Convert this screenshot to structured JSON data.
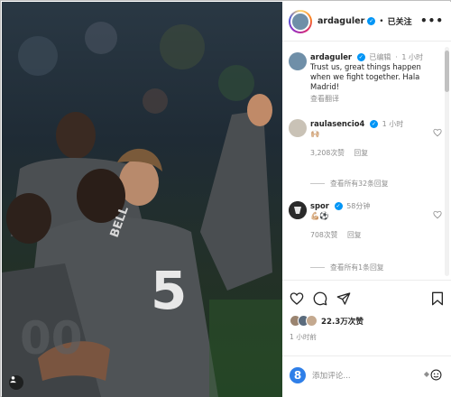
{
  "post": {
    "author": "ardaguler",
    "follow_status": "已关注",
    "more_label": "•••",
    "caption": {
      "edited": "已编辑",
      "time": "1 小时",
      "text": "Trust us, great things happen when we fight together. Hala Madrid!",
      "translate": "查看翻译"
    },
    "likes": "22.3万次赞",
    "time": "1 小时前"
  },
  "comments": [
    {
      "user": "raulasencio4",
      "time": "1 小时",
      "text": "🙌🏼",
      "likes": "3,208次赞",
      "reply_label": "回复",
      "replies_label": "查看所有32条回复"
    },
    {
      "user": "spor",
      "time": "58分钟",
      "text": "💪🏼⚽",
      "likes": "708次赞",
      "reply_label": "回复",
      "replies_label": "查看所有1条回复"
    }
  ],
  "comment_box": {
    "placeholder": "添加评论..."
  },
  "photo": {
    "jersey_number": "5",
    "jersey_name": "BELL"
  },
  "icons": [
    "heart-icon",
    "comment-icon",
    "share-icon",
    "save-icon",
    "emoji-icon",
    "smile-icon",
    "more-icon",
    "verified-icon"
  ],
  "colors": {
    "verified": "#0095f6",
    "meta_text": "#8e8e8e",
    "emoji_button": "#2f7fe8"
  }
}
